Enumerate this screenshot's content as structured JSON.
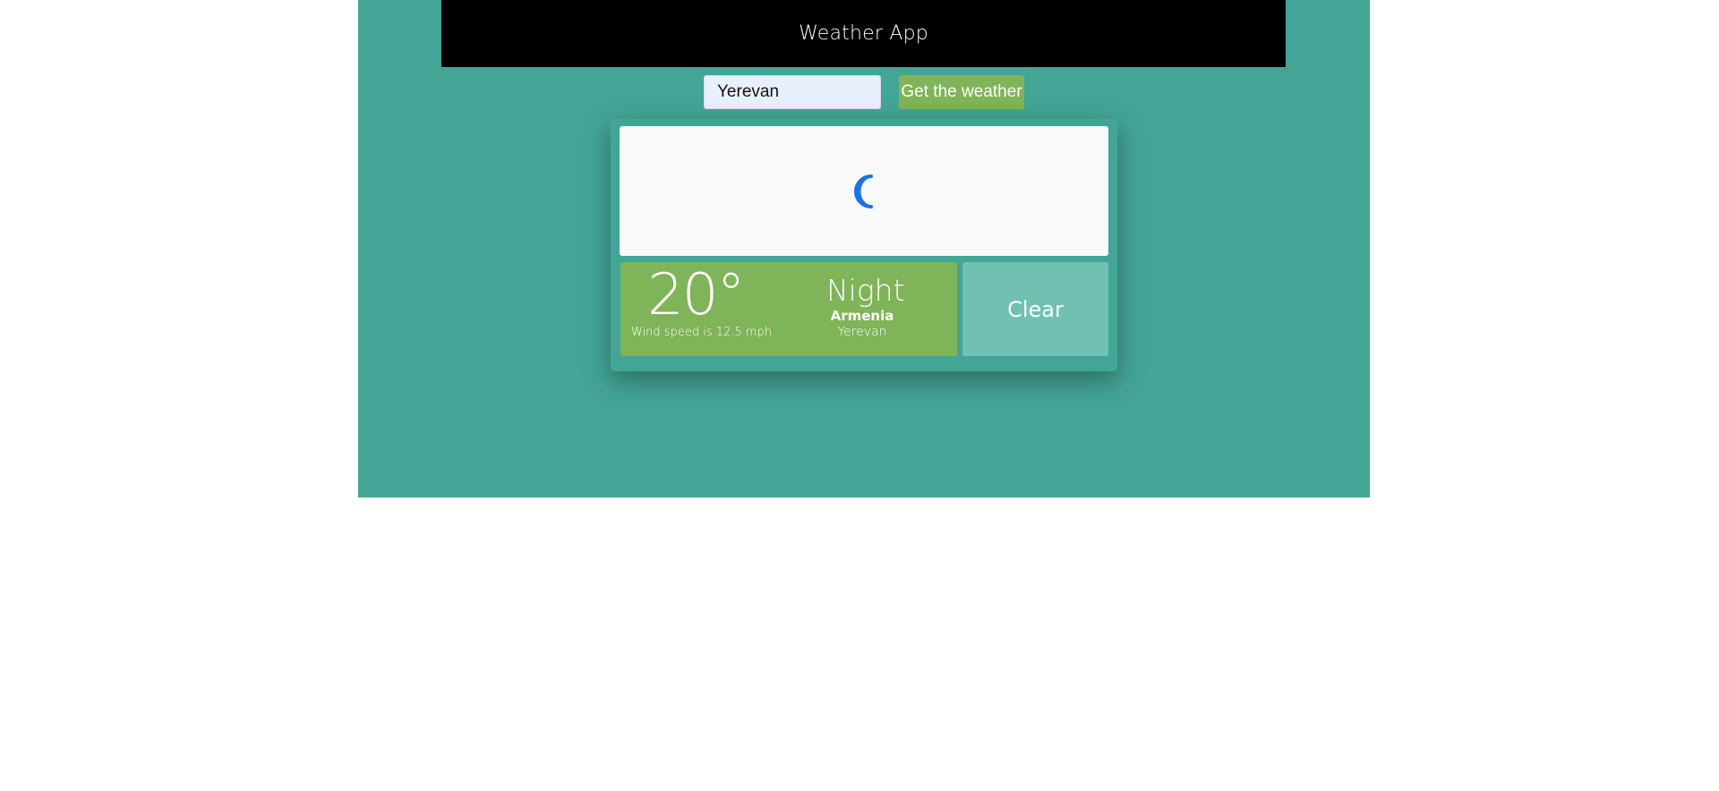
{
  "header": {
    "title": "Weather App"
  },
  "search": {
    "city_value": "Yerevan",
    "button_label": "Get the weather"
  },
  "weather": {
    "icon": "moon-icon",
    "temperature": "20°",
    "wind_text": "Wind speed is 12.5 mph",
    "condition": "Night",
    "country": "Armenia",
    "city": "Yerevan",
    "clear_label": "Clear"
  },
  "colors": {
    "frame_background": "#43a596",
    "header_background": "#000000",
    "accent_green": "#7fb458",
    "clear_teal": "#70c1b2",
    "icon_panel_background": "#f9f9f9",
    "moon_blue": "#1a73e8"
  }
}
